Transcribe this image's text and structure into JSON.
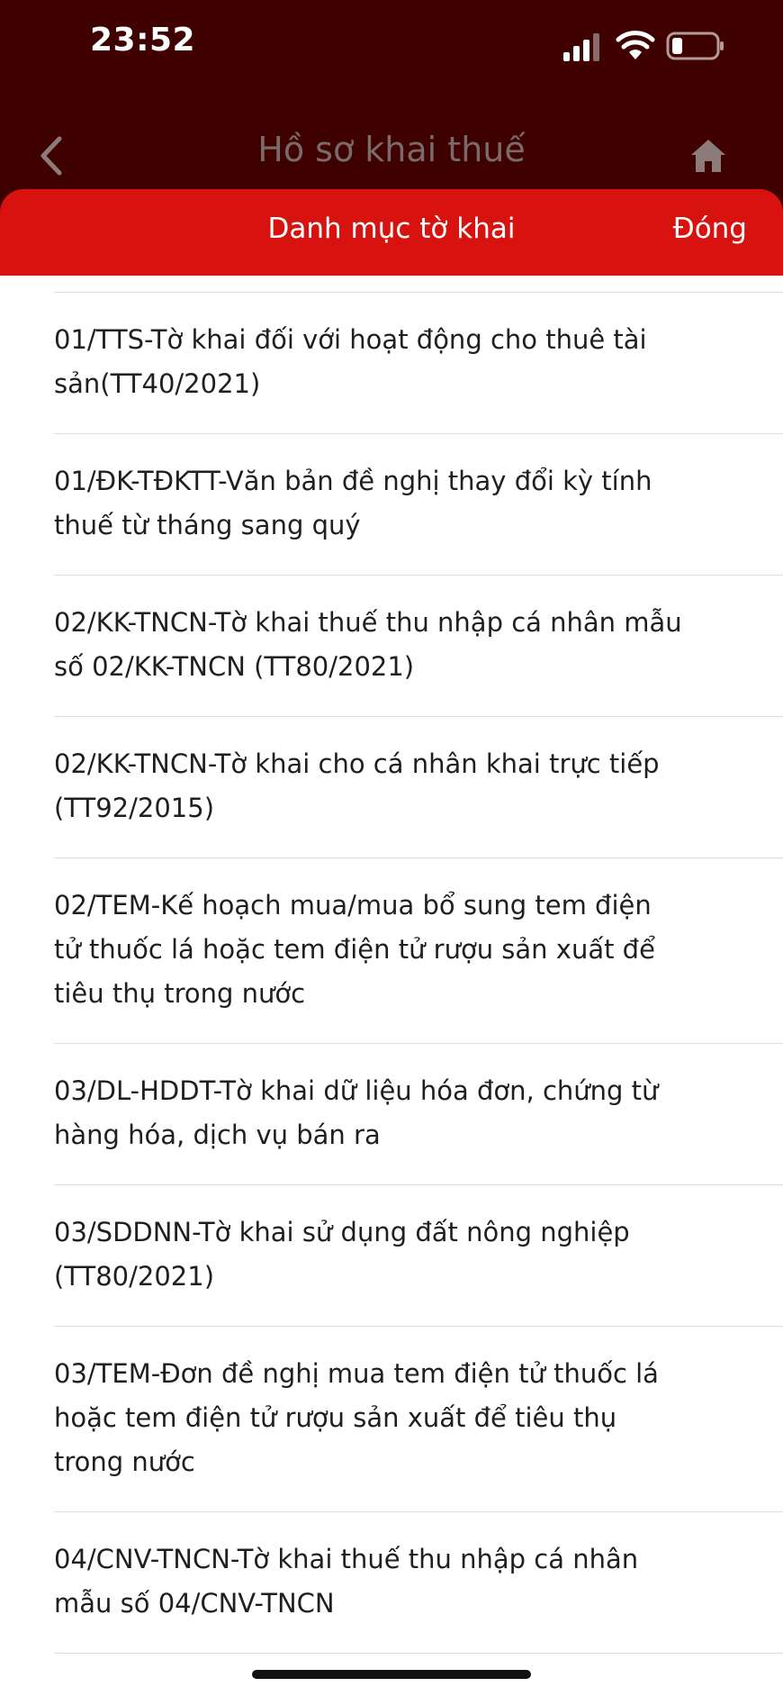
{
  "status_bar": {
    "time": "23:52"
  },
  "header": {
    "title": "Hồ sơ khai thuế",
    "background": "#3f0000"
  },
  "sheet": {
    "title": "Danh mục tờ khai",
    "close_label": "Đóng",
    "accent": "#d7120f"
  },
  "icons": {
    "back": "chevron-left-icon",
    "home": "home-icon",
    "signal": "cellular-signal-icon",
    "wifi": "wifi-icon",
    "battery": "battery-icon"
  },
  "items": [
    {
      "label": "01/TTS-Tờ khai đối với hoạt động cho thuê tài sản(TT40/2021)"
    },
    {
      "label": "01/ĐK-TĐKTT-Văn bản đề nghị thay đổi kỳ tính thuế từ tháng sang quý"
    },
    {
      "label": "02/KK-TNCN-Tờ khai thuế thu nhập cá nhân mẫu số 02/KK-TNCN (TT80/2021)"
    },
    {
      "label": "02/KK-TNCN-Tờ khai cho cá nhân khai trực tiếp (TT92/2015)"
    },
    {
      "label": "02/TEM-Kế hoạch mua/mua bổ sung tem điện tử thuốc lá hoặc tem điện tử rượu sản xuất để tiêu thụ trong nước"
    },
    {
      "label": "03/DL-HDDT-Tờ khai dữ liệu hóa đơn, chứng từ hàng hóa, dịch vụ bán ra"
    },
    {
      "label": "03/SDDNN-Tờ khai sử dụng đất nông nghiệp (TT80/2021)"
    },
    {
      "label": "03/TEM-Đơn đề nghị mua tem điện tử thuốc lá hoặc tem điện tử rượu sản xuất để tiêu thụ trong nước"
    },
    {
      "label": "04/CNV-TNCN-Tờ khai thuế thu nhập cá nhân mẫu số 04/CNV-TNCN"
    }
  ]
}
